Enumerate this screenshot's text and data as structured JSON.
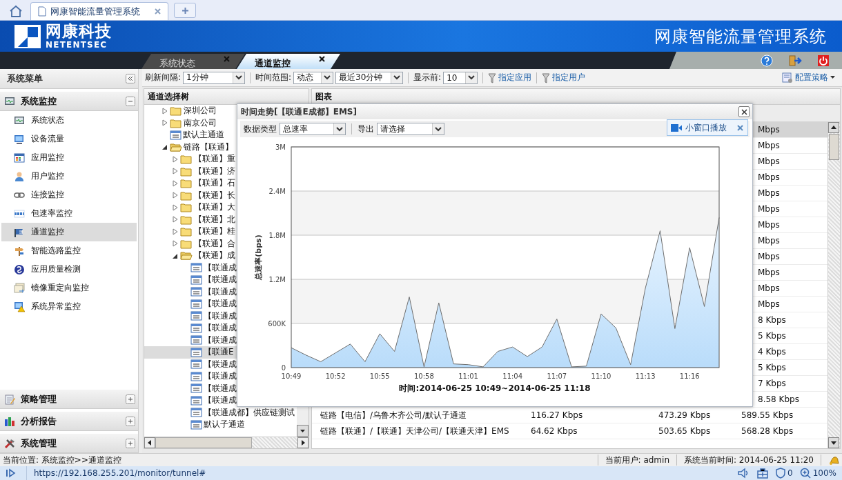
{
  "browser": {
    "tab_title": "网康智能流量管理系统",
    "url": "https://192.168.255.201/monitor/tunnel#",
    "shield_count": "0",
    "zoom": "100%"
  },
  "header": {
    "logo_cn": "网康科技",
    "logo_en": "NETENTSEC",
    "title": "网康智能流量管理系统"
  },
  "tabs": [
    {
      "label": "系统状态",
      "selected": false
    },
    {
      "label": "通道监控",
      "selected": true
    }
  ],
  "sidebar": {
    "title": "系统菜单",
    "sections": [
      {
        "label": "系统监控",
        "expanded": true,
        "items": [
          {
            "label": "系统状态",
            "selected": false
          },
          {
            "label": "设备流量",
            "selected": false
          },
          {
            "label": "应用监控",
            "selected": false
          },
          {
            "label": "用户监控",
            "selected": false
          },
          {
            "label": "连接监控",
            "selected": false
          },
          {
            "label": "包速率监控",
            "selected": false
          },
          {
            "label": "通道监控",
            "selected": true
          },
          {
            "label": "智能选路监控",
            "selected": false
          },
          {
            "label": "应用质量检测",
            "selected": false
          },
          {
            "label": "镜像重定向监控",
            "selected": false
          },
          {
            "label": "系统异常监控",
            "selected": false
          }
        ]
      },
      {
        "label": "策略管理",
        "expanded": false
      },
      {
        "label": "分析报告",
        "expanded": false
      },
      {
        "label": "系统管理",
        "expanded": false
      }
    ]
  },
  "toolbar": {
    "refresh_label": "刷新间隔:",
    "refresh_value": "1分钟",
    "range_label": "时间范围:",
    "range_mode": "动态",
    "range_value": "最近30分钟",
    "top_label": "显示前:",
    "top_value": "10",
    "filter_app": "指定应用",
    "filter_user": "指定用户",
    "config": "配置策略"
  },
  "tree": {
    "title": "通道选择树",
    "items": [
      {
        "label": "深圳公司",
        "kind": "folder",
        "expanded": false,
        "selected": false
      },
      {
        "label": "南京公司",
        "kind": "folder",
        "expanded": false,
        "selected": false
      },
      {
        "label": "默认主通道",
        "kind": "channel",
        "selected": false
      },
      {
        "label": "链路【联通】",
        "kind": "folder",
        "expanded": true,
        "selected": false,
        "children": [
          {
            "label": "【联通】重",
            "kind": "folder",
            "expanded": false,
            "selected": false
          },
          {
            "label": "【联通】济",
            "kind": "folder",
            "expanded": false,
            "selected": false
          },
          {
            "label": "【联通】石",
            "kind": "folder",
            "expanded": false,
            "selected": false
          },
          {
            "label": "【联通】长",
            "kind": "folder",
            "expanded": false,
            "selected": false
          },
          {
            "label": "【联通】大",
            "kind": "folder",
            "expanded": false,
            "selected": false
          },
          {
            "label": "【联通】北",
            "kind": "folder",
            "expanded": false,
            "selected": false
          },
          {
            "label": "【联通】桂",
            "kind": "folder",
            "expanded": false,
            "selected": false
          },
          {
            "label": "【联通】合",
            "kind": "folder",
            "expanded": false,
            "selected": false
          },
          {
            "label": "【联通】成",
            "kind": "folder",
            "expanded": true,
            "selected": false,
            "children": [
              {
                "label": "【联通成",
                "kind": "channel",
                "selected": false
              },
              {
                "label": "【联通成",
                "kind": "channel",
                "selected": false
              },
              {
                "label": "【联通成",
                "kind": "channel",
                "selected": false
              },
              {
                "label": "【联通成",
                "kind": "channel",
                "selected": false
              },
              {
                "label": "【联通成",
                "kind": "channel",
                "selected": false
              },
              {
                "label": "【联通成",
                "kind": "channel",
                "selected": false
              },
              {
                "label": "【联通成",
                "kind": "channel",
                "selected": false
              },
              {
                "label": "【联通E",
                "kind": "channel",
                "selected": true
              },
              {
                "label": "【联通成",
                "kind": "channel",
                "selected": false
              },
              {
                "label": "【联通成",
                "kind": "channel",
                "selected": false
              },
              {
                "label": "【联通成",
                "kind": "channel",
                "selected": false
              },
              {
                "label": "【联通成",
                "kind": "channel",
                "selected": false
              },
              {
                "label": "【联通成都】供应链测试",
                "kind": "channel",
                "selected": false
              },
              {
                "label": "默认子通道",
                "kind": "channel",
                "selected": false
              }
            ]
          }
        ]
      }
    ]
  },
  "chart_panel": {
    "title": "图表",
    "rows": [
      {
        "kind": "covered",
        "selected": true,
        "cells": [
          "Mbps"
        ]
      },
      {
        "kind": "covered",
        "selected": false,
        "cells": [
          "Mbps"
        ]
      },
      {
        "kind": "covered",
        "selected": false,
        "cells": [
          "Mbps"
        ]
      },
      {
        "kind": "covered",
        "selected": false,
        "cells": [
          "Mbps"
        ]
      },
      {
        "kind": "covered",
        "selected": false,
        "cells": [
          "Mbps"
        ]
      },
      {
        "kind": "covered",
        "selected": false,
        "cells": [
          "Mbps"
        ]
      },
      {
        "kind": "covered",
        "selected": false,
        "cells": [
          "Mbps"
        ]
      },
      {
        "kind": "covered",
        "selected": false,
        "cells": [
          "Mbps"
        ]
      },
      {
        "kind": "covered",
        "selected": false,
        "cells": [
          "Mbps"
        ]
      },
      {
        "kind": "covered",
        "selected": false,
        "cells": [
          "Mbps"
        ]
      },
      {
        "kind": "covered",
        "selected": false,
        "cells": [
          "Mbps"
        ]
      },
      {
        "kind": "covered",
        "selected": false,
        "cells": [
          "Mbps"
        ]
      },
      {
        "kind": "covered",
        "selected": false,
        "cells": [
          "8 Kbps"
        ]
      },
      {
        "kind": "covered",
        "selected": false,
        "cells": [
          "5 Kbps"
        ]
      },
      {
        "kind": "covered",
        "selected": false,
        "cells": [
          "4 Kbps"
        ]
      },
      {
        "kind": "covered",
        "selected": false,
        "cells": [
          "5 Kbps"
        ]
      },
      {
        "kind": "covered",
        "selected": false,
        "cells": [
          "7 Kbps"
        ]
      },
      {
        "kind": "covered",
        "selected": false,
        "cells": [
          "8.58 Kbps"
        ]
      },
      {
        "kind": "full",
        "selected": false,
        "cells": [
          "链路【电信】/乌鲁木齐公司/默认子通道",
          "116.27 Kbps",
          "473.29 Kbps",
          "589.55 Kbps"
        ]
      },
      {
        "kind": "full",
        "selected": false,
        "cells": [
          "链路【联通】/【联通】天津公司/【联通天津】EMS",
          "64.62 Kbps",
          "503.65 Kbps",
          "568.28 Kbps"
        ]
      }
    ]
  },
  "dialog": {
    "title": "时间走势[【联通E成都】EMS]",
    "data_type_label": "数据类型",
    "data_type_value": "总速率",
    "export_label": "导出",
    "export_value": "请选择",
    "mini_window": "小窗口播放",
    "time_range": "时间:2014-06-25 10:49~2014-06-25 11:18",
    "chart_data": {
      "type": "area",
      "ylabel": "总速率(bps)",
      "grid": true,
      "categories": [
        "10:49",
        null,
        null,
        "10:52",
        null,
        null,
        "10:55",
        null,
        null,
        "10:58",
        null,
        null,
        "11:01",
        null,
        null,
        "11:04",
        null,
        null,
        "11:07",
        null,
        null,
        "11:10",
        null,
        null,
        "11:13",
        null,
        null,
        "11:16",
        null,
        null
      ],
      "series": [
        {
          "color": "#b9dcfa",
          "values": [
            270000,
            170000,
            80000,
            200000,
            320000,
            80000,
            460000,
            220000,
            960000,
            10000,
            880000,
            50000,
            40000,
            10000,
            220000,
            280000,
            150000,
            280000,
            660000,
            10000,
            20000,
            730000,
            540000,
            40000,
            1080000,
            1860000,
            530000,
            1630000,
            830000,
            2040000
          ]
        }
      ],
      "ylim": [
        0,
        3000000
      ],
      "yticks": [
        {
          "value": 0,
          "label": "0"
        },
        {
          "value": 600000,
          "label": "600K"
        },
        {
          "value": 1200000,
          "label": "1.2M"
        },
        {
          "value": 1800000,
          "label": "1.8M"
        },
        {
          "value": 2400000,
          "label": "2.4M"
        },
        {
          "value": 3000000,
          "label": "3M"
        }
      ]
    }
  },
  "status_bar": {
    "location": "当前位置: 系统监控>>通道监控",
    "user": "当前用户: admin",
    "time": "系统当前时间: 2014-06-25 11:20"
  }
}
